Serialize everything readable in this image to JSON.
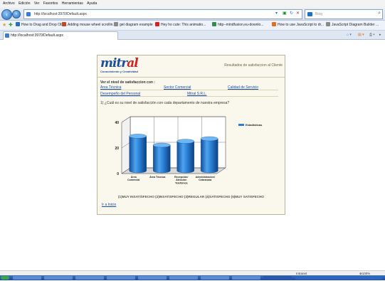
{
  "browser": {
    "menu": [
      "Archivo",
      "Edición",
      "Ver",
      "Favoritos",
      "Herramientas",
      "Ayuda"
    ],
    "address": "http://localhost:3970/Default.aspx",
    "search_placeholder": "Bing",
    "favorites": [
      "How to Drag and Drop Obje...",
      "Adding mouse wheel scrollin...",
      "get diagram example",
      "Hey ho cute: This animatio...",
      "http--mindfusion.eu-downlo...",
      "How to use JavaScript to dr...",
      "JavaScript Diagram Builder ..."
    ],
    "tab_title": "http://localhost:3970/Default.aspx",
    "status_zone": "Intranet local",
    "status_zoom": "100%"
  },
  "page": {
    "logo_text": "mitr",
    "logo_text2": "al",
    "logo_tagline": "Conocimiento y Creatividad",
    "header_title": "Resultados de satisfaccion al Cliente",
    "section_title": "Ver el nivel de satisfaccion con :",
    "links": [
      "Area Técnica",
      "Sector Comercial",
      "Calidad de Servicio",
      "Desempeño del Personal",
      "Mitral S.R.L."
    ],
    "question": "1) ¿Cuál es su nivel de satisfacción con cada departamento de nuestra empresa?",
    "footer": "(1)MUY INSATISFECHO (2)INSATISFECHO (3)REGULAR (4)SATISFECHO (5)MUY SATISFECHO",
    "back_link": "Ir a Inicio"
  },
  "chart_data": {
    "type": "bar",
    "categories": [
      "Área Comercial",
      "Área Técnica",
      "Recepción/Atención Telefónica",
      "Administración/Cobranzas"
    ],
    "series": [
      {
        "name": "Estadisticas",
        "values": [
          27,
          20,
          23,
          25
        ]
      }
    ],
    "yticks": [
      0,
      20,
      40
    ],
    "ylim": [
      0,
      40
    ],
    "legend_position": "top-right",
    "bar_color": "#2a7fd4"
  }
}
